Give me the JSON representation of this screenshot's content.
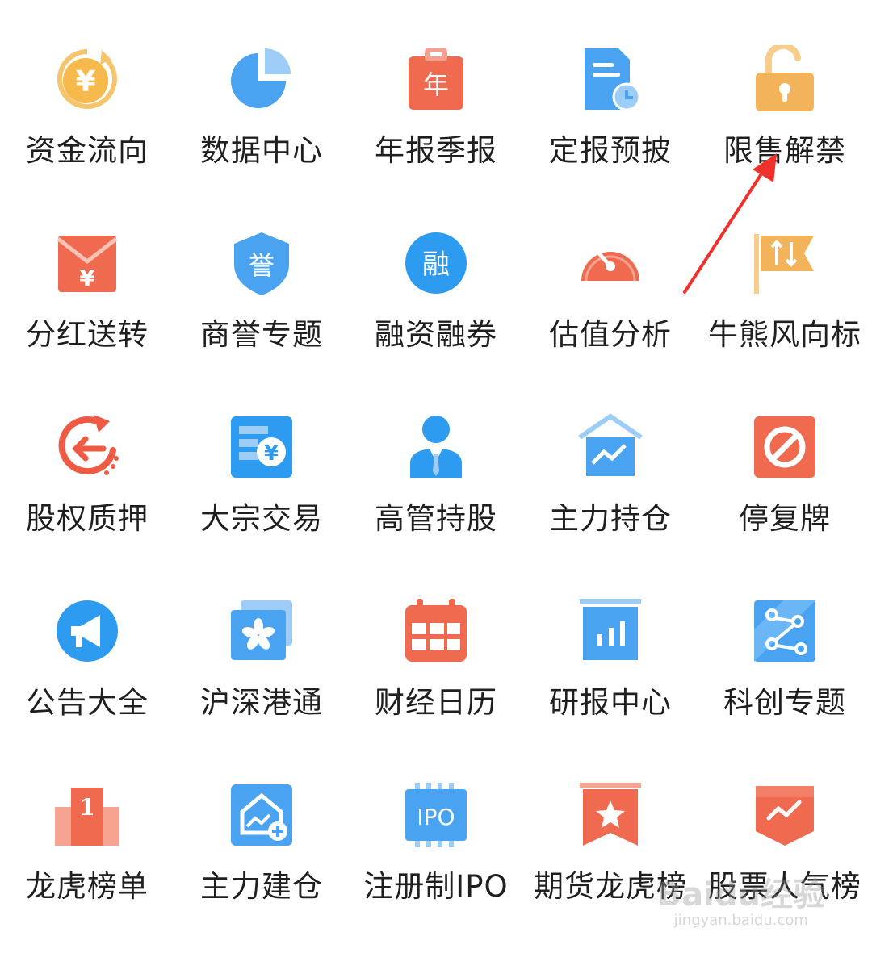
{
  "colors": {
    "accent_blue": "#4aa3f0",
    "accent_orange": "#f2b35a",
    "accent_red": "#ef6a4f",
    "annotation_arrow": "#f0302a"
  },
  "tiles": [
    {
      "label": "资金流向",
      "icon": "yuan-coin-icon"
    },
    {
      "label": "数据中心",
      "icon": "pie-chart-icon"
    },
    {
      "label": "年报季报",
      "icon": "annual-report-clipboard-icon",
      "glyph": "年"
    },
    {
      "label": "定报预披",
      "icon": "document-clock-icon"
    },
    {
      "label": "限售解禁",
      "icon": "open-padlock-icon"
    },
    {
      "label": "分红送转",
      "icon": "red-envelope-icon",
      "glyph": "¥"
    },
    {
      "label": "商誉专题",
      "icon": "shield-badge-icon",
      "glyph": "誉"
    },
    {
      "label": "融资融券",
      "icon": "margin-circle-icon",
      "glyph": "融"
    },
    {
      "label": "估值分析",
      "icon": "gauge-icon"
    },
    {
      "label": "牛熊风向标",
      "icon": "flag-arrows-icon"
    },
    {
      "label": "股权质押",
      "icon": "circular-arrow-icon"
    },
    {
      "label": "大宗交易",
      "icon": "ledger-coin-icon",
      "glyph": "¥"
    },
    {
      "label": "高管持股",
      "icon": "executive-person-icon"
    },
    {
      "label": "主力持仓",
      "icon": "house-trend-icon"
    },
    {
      "label": "停复牌",
      "icon": "prohibited-sign-icon"
    },
    {
      "label": "公告大全",
      "icon": "megaphone-icon"
    },
    {
      "label": "沪深港通",
      "icon": "hk-bauhinia-card-icon"
    },
    {
      "label": "财经日历",
      "icon": "calendar-icon"
    },
    {
      "label": "研报中心",
      "icon": "bar-chart-board-icon"
    },
    {
      "label": "科创专题",
      "icon": "science-network-icon"
    },
    {
      "label": "龙虎榜单",
      "icon": "podium-first-icon",
      "glyph": "1"
    },
    {
      "label": "主力建仓",
      "icon": "house-plus-icon"
    },
    {
      "label": "注册制IPO",
      "icon": "ipo-chip-icon",
      "glyph": "IPO"
    },
    {
      "label": "期货龙虎榜",
      "icon": "star-banner-icon"
    },
    {
      "label": "股票人气榜",
      "icon": "trend-banner-icon"
    }
  ],
  "watermark": {
    "top": "Baidu经验",
    "bottom": "jingyan.baidu.com"
  }
}
